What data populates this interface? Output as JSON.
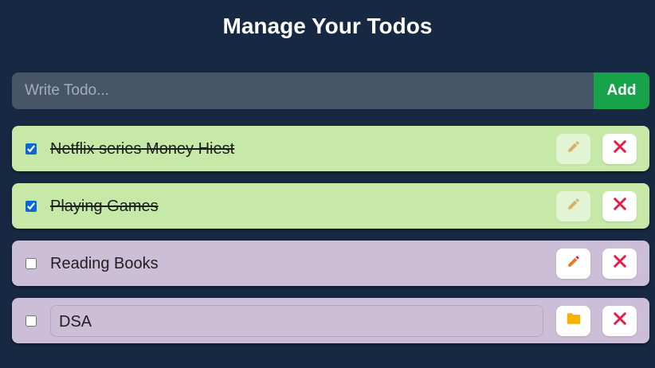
{
  "header": {
    "title": "Manage Your Todos"
  },
  "add_form": {
    "placeholder": "Write Todo...",
    "value": "",
    "add_label": "Add"
  },
  "colors": {
    "background": "#172842",
    "completed_row": "#c6e9a7",
    "pending_row": "#ccbed7",
    "add_button": "#16a34a",
    "delete_icon": "#e11d48",
    "edit_icon": "#e07b2a",
    "save_icon": "#f5b301"
  },
  "todos": [
    {
      "text": "Netflix series Money Hiest",
      "completed": true,
      "editing": false,
      "edit_icon": "pencil-icon",
      "delete_icon": "close-icon"
    },
    {
      "text": "Playing Games",
      "completed": true,
      "editing": false,
      "edit_icon": "pencil-icon",
      "delete_icon": "close-icon"
    },
    {
      "text": "Reading Books",
      "completed": false,
      "editing": false,
      "edit_icon": "pencil-icon",
      "delete_icon": "close-icon"
    },
    {
      "text": "DSA",
      "completed": false,
      "editing": true,
      "edit_icon": "folder-icon",
      "delete_icon": "close-icon"
    }
  ]
}
